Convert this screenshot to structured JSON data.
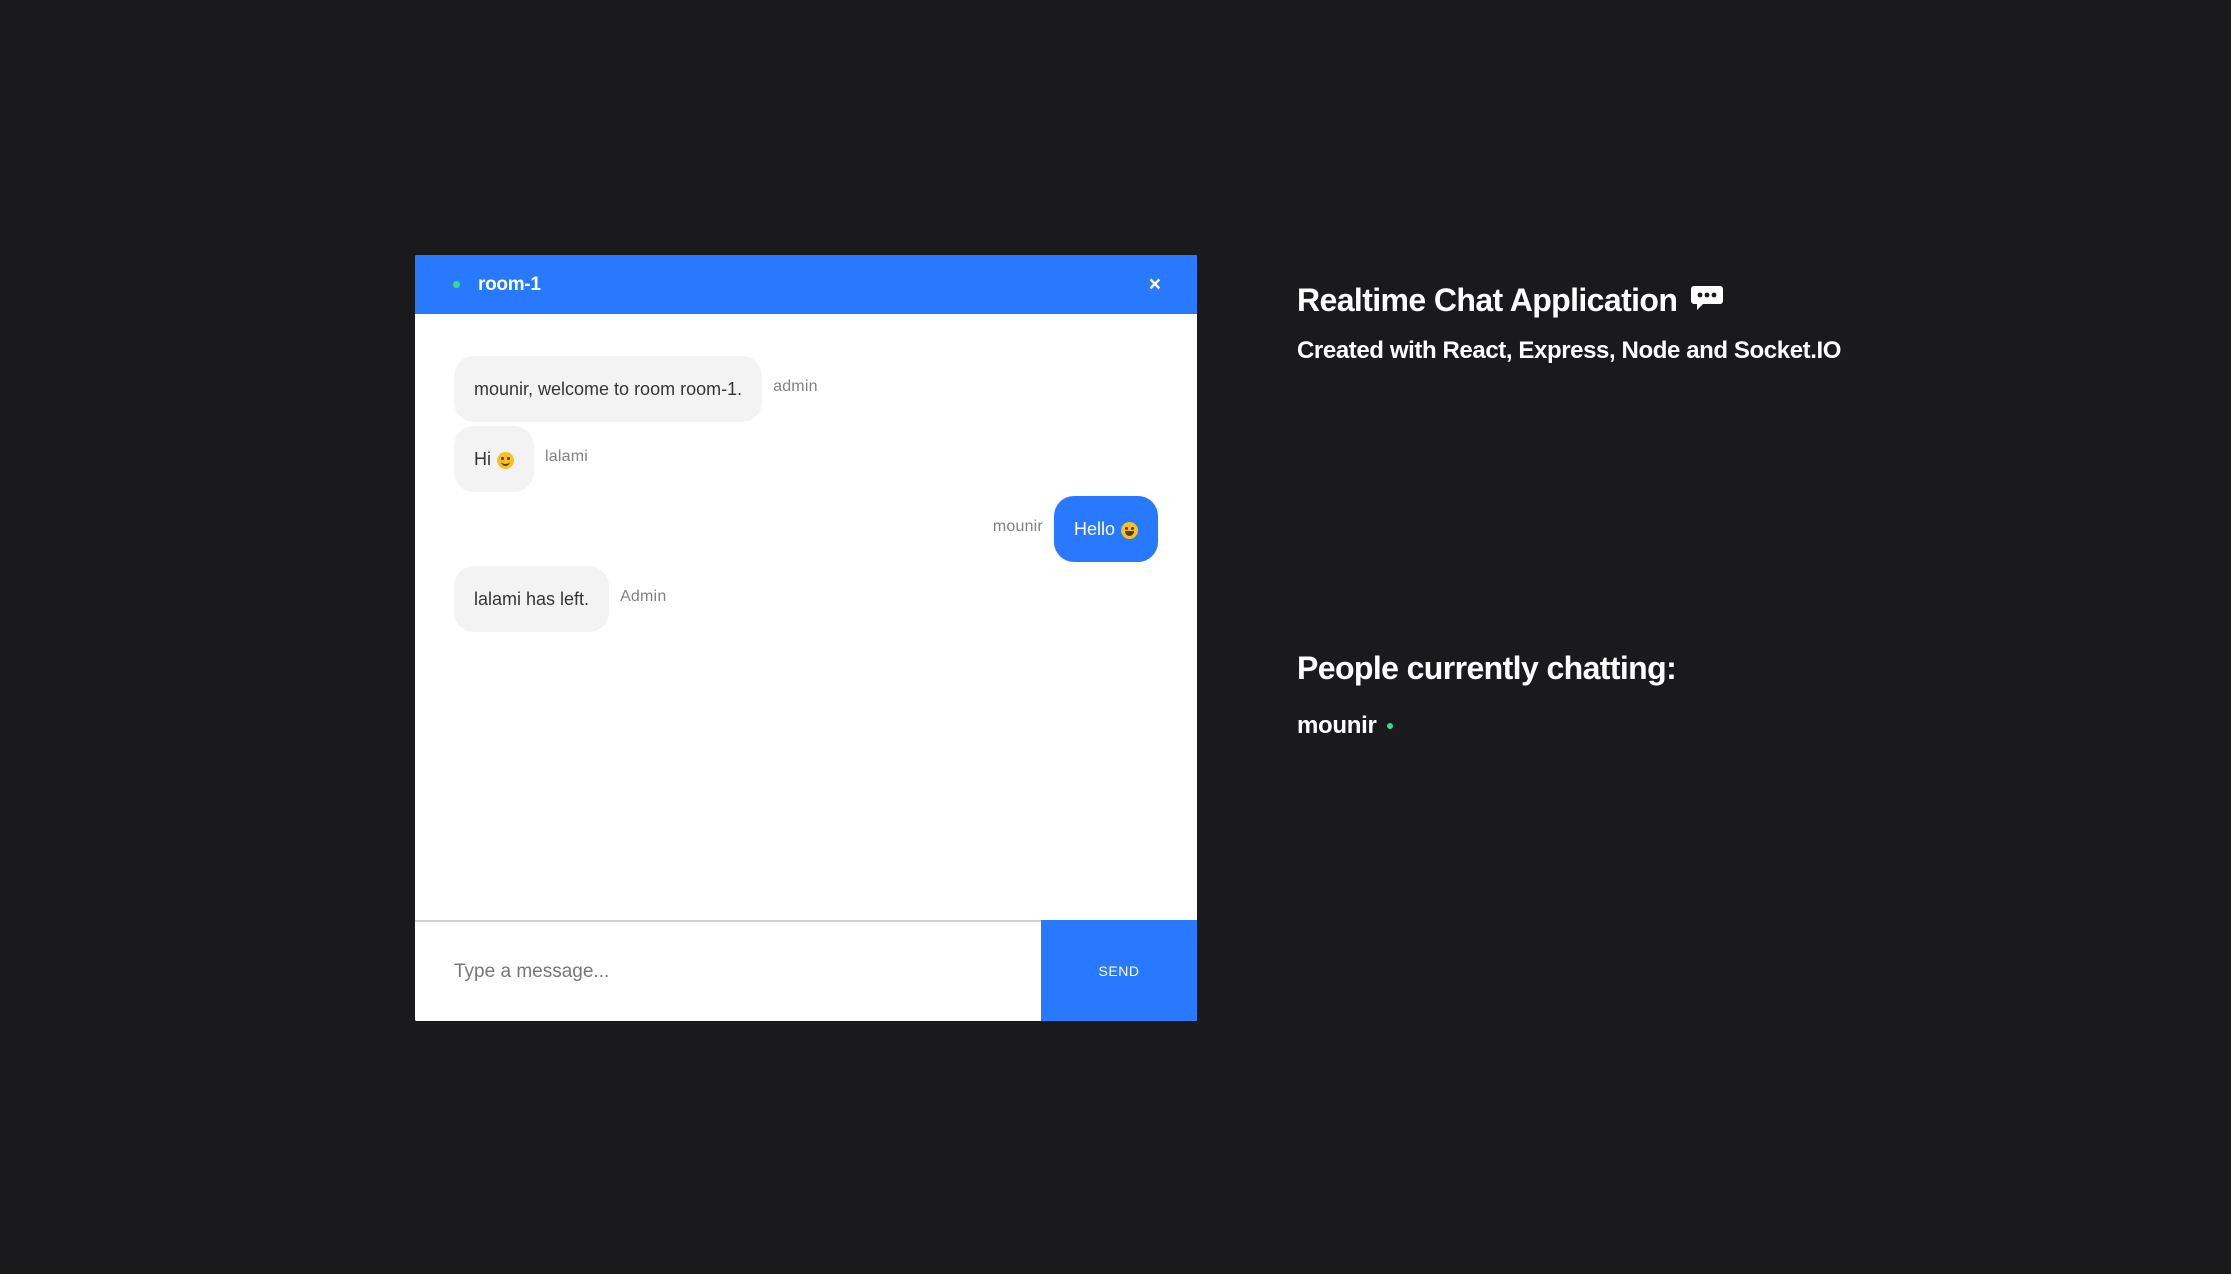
{
  "room": {
    "name": "room-1",
    "close_label": "×"
  },
  "messages": [
    {
      "text": "mounir, welcome to room room-1.",
      "sender": "admin",
      "side": "left",
      "emoji": ""
    },
    {
      "text": "Hi",
      "sender": "lalami",
      "side": "left",
      "emoji": "slightly-smiling-face-icon"
    },
    {
      "text": "Hello",
      "sender": "mounir",
      "side": "right",
      "emoji": "grinning-face-icon"
    },
    {
      "text": "lalami has left.",
      "sender": "Admin",
      "side": "left",
      "emoji": ""
    }
  ],
  "input": {
    "placeholder": "Type a message...",
    "value": ""
  },
  "send_label": "SEND",
  "info": {
    "title": "Realtime Chat Application",
    "title_icon": "speech-bubble-icon",
    "subtitle": "Created with React, Express, Node and Socket.IO"
  },
  "people": {
    "title": "People currently chatting:",
    "users": [
      {
        "name": "mounir",
        "status": "online"
      }
    ]
  },
  "colors": {
    "background": "#1a1a1d",
    "accent": "#2979ff",
    "online": "#39d98a",
    "bubble_light": "#f3f3f3"
  }
}
